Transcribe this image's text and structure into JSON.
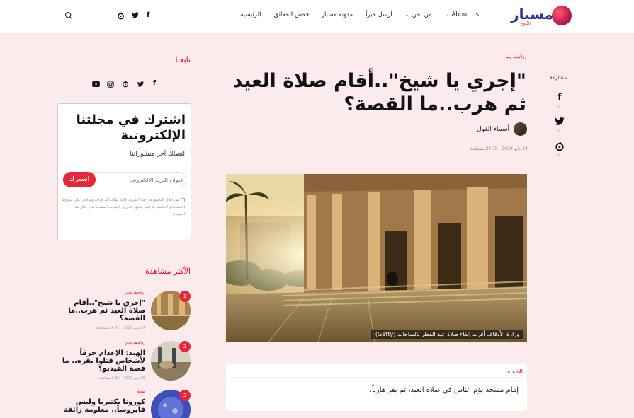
{
  "header": {
    "logo_text": "مسبار",
    "logo_sub": "البلوغ",
    "nav": [
      {
        "label": "الرئيسية",
        "has_chevron": false
      },
      {
        "label": "فحص الحقائق",
        "has_chevron": false
      },
      {
        "label": "مدونة مسبار",
        "has_chevron": false
      },
      {
        "label": "أرسل خبراً",
        "has_chevron": false
      },
      {
        "label": "من نحن",
        "has_chevron": true
      },
      {
        "label": "About Us",
        "has_chevron": true
      }
    ],
    "social": [
      "f",
      "twitter",
      "o"
    ]
  },
  "share": {
    "label": "مشاركة",
    "items": [
      {
        "icon": "facebook-icon",
        "count": "0"
      },
      {
        "icon": "twitter-icon",
        "count": "0"
      },
      {
        "icon": "other-icon",
        "count": "0"
      }
    ]
  },
  "article": {
    "category": "زواجيف وتين",
    "title": "\"إجري يا شيخ\"..أقام صلاة العيد ثم هرب..ما القصة؟",
    "author": "أسماء الغول",
    "date": "24 مايو 2020",
    "views": "24.7k مشاهدة",
    "image_caption": "وزارة الأوقاف أقرت إلغاء صلاة عيد الفطر بالساحات (Getty)",
    "summary_label": "الادعاء",
    "summary_text": "إمام مسجد يؤم الناس في صلاة العيد، ثم يفر هارباً."
  },
  "sidebar": {
    "follow_title": "تابعنا",
    "subscribe": {
      "title": "اشترك في مجلتنا الإلكترونية",
      "desc": "لتصلك آخر منشوراتنا",
      "placeholder": "عنوان البريد الإلكتروني",
      "button": "اشترك",
      "consent": "من خلال التحقق من هذا المربع، فإنك تؤكد أنك قرأت وتوافق على شروط الاستخدام الخاصة بنا فيما يتعلق بتخزين البيانات المقدمة من خلال هذا النموذج."
    },
    "most_viewed_title": "الأكثر مشاهدة",
    "most_viewed": [
      {
        "num": "1",
        "cat": "زواجيف وتين",
        "title": "\"إجري يا شيخ\"..أقام صلاة العيد ثم هرب..ما القصة؟",
        "date": "24 مايو 2020",
        "views": "24.7k مشاهدة"
      },
      {
        "num": "2",
        "cat": "زواجيف وتين",
        "title": "الهند: الإعدام حرقاً لأشخاص قتلوا بقرة.. ما قصة الفيديو؟",
        "date": "26 مايو 2020",
        "views": "3.2k مشاهدة"
      },
      {
        "num": "3",
        "cat": "صحة",
        "title": "كورونا بكتيريا وليس فايروساً.. معلومة زائفة",
        "date": "",
        "views": ""
      }
    ]
  }
}
